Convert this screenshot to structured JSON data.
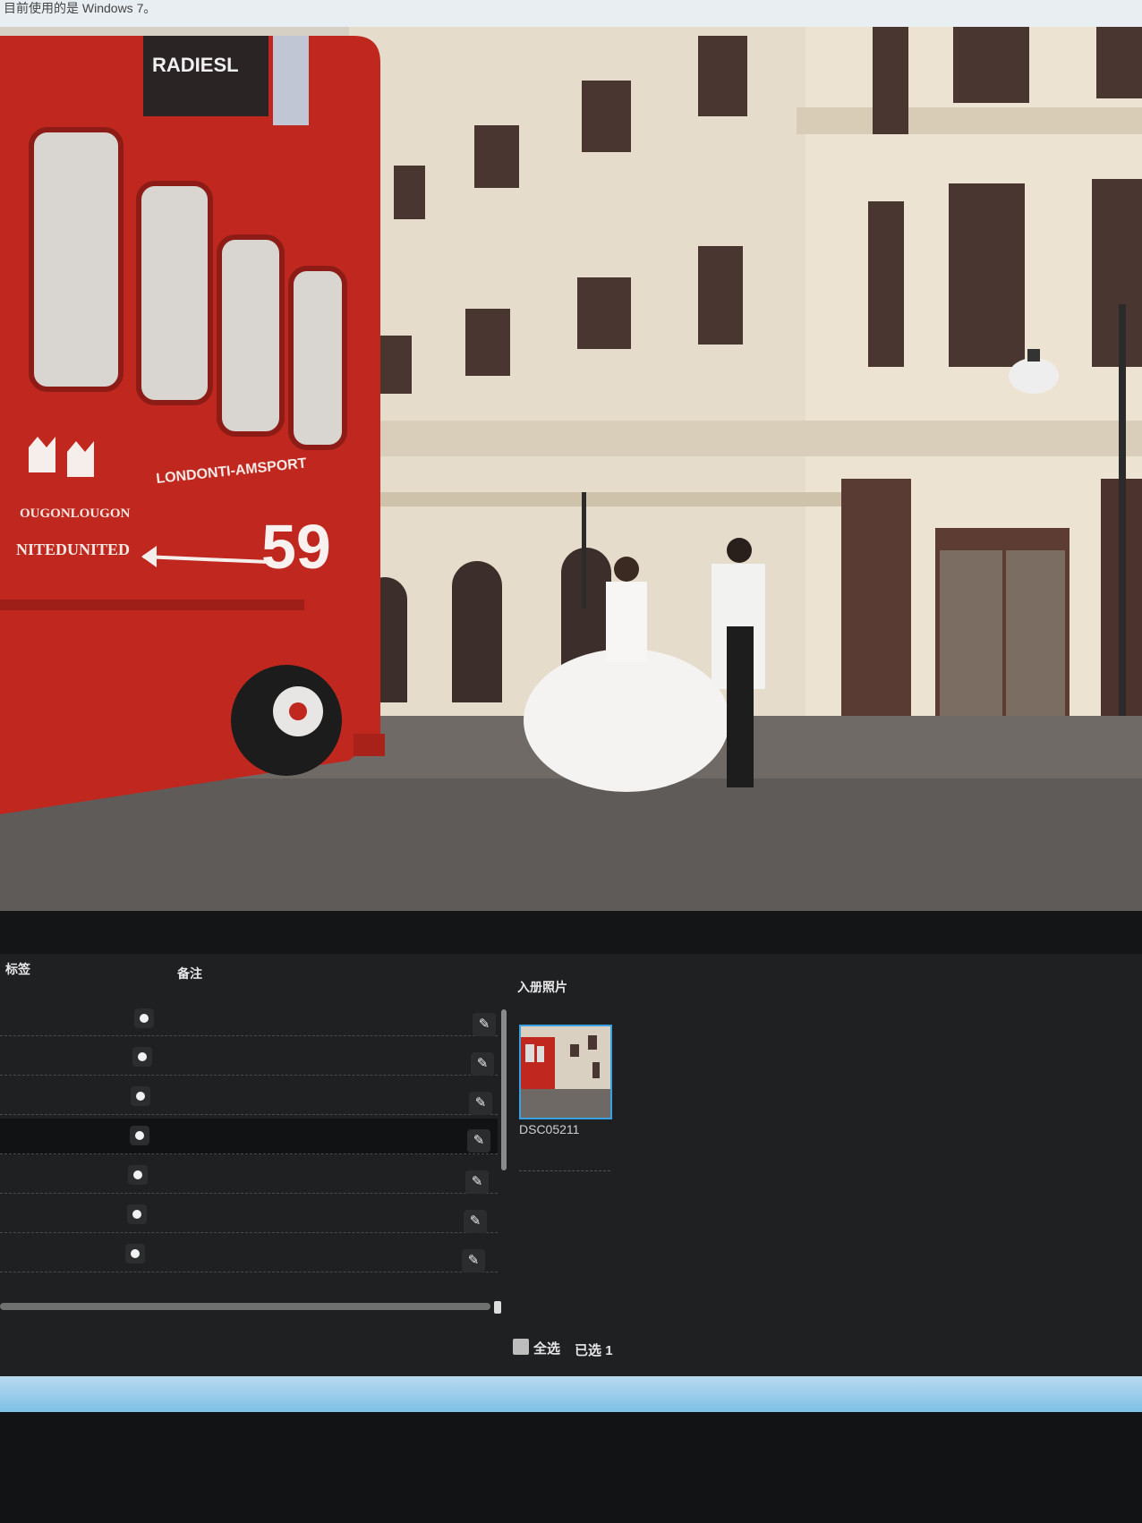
{
  "notice": {
    "text": "目前使用的是 Windows 7。"
  },
  "photo": {
    "bus_sign_top": "RADIESL",
    "bus_route_text": "LONDONTI-AMSPORT",
    "bus_number": "59",
    "bus_logo_text_1": "OUGONLOUGON",
    "bus_logo_text_2": "NITEDUNITED"
  },
  "panel": {
    "col_tag": "标签",
    "col_note": "备注",
    "col_album": "入册照片",
    "rows": 7,
    "selected_row": 4,
    "thumbnail_name": "DSC05211",
    "select_all_label": "全选",
    "selected_label": "已选",
    "selected_count": "1"
  },
  "colors": {
    "panel_bg": "#1e2021",
    "thumb_border": "#3aa0e0",
    "bus_red": "#c0281f"
  }
}
